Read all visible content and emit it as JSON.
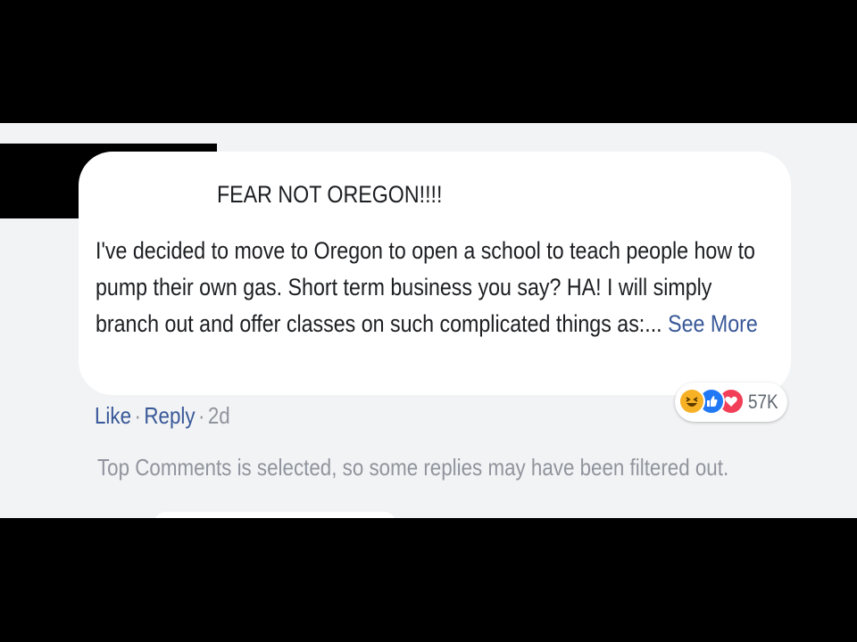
{
  "comment": {
    "header": "FEAR NOT OREGON!!!!",
    "body": "I've decided to move to Oregon to open a school to teach people how to pump their own gas. Short term business you say? HA! I will simply branch out and offer classes on such complicated things as:...",
    "see_more": "See More"
  },
  "reactions": {
    "icons": [
      "haha-icon",
      "like-icon",
      "love-icon"
    ],
    "count": "57K"
  },
  "actions": {
    "like": "Like",
    "separator": "·",
    "reply": "Reply",
    "timestamp": "2d"
  },
  "filter_note": "Top Comments is selected, so some replies may have been filtered out.",
  "colors": {
    "link": "#385898",
    "text": "#1c1e21",
    "muted": "#90949c",
    "haha": "#f7b125",
    "like": "#2078f4",
    "love": "#f33e58"
  }
}
